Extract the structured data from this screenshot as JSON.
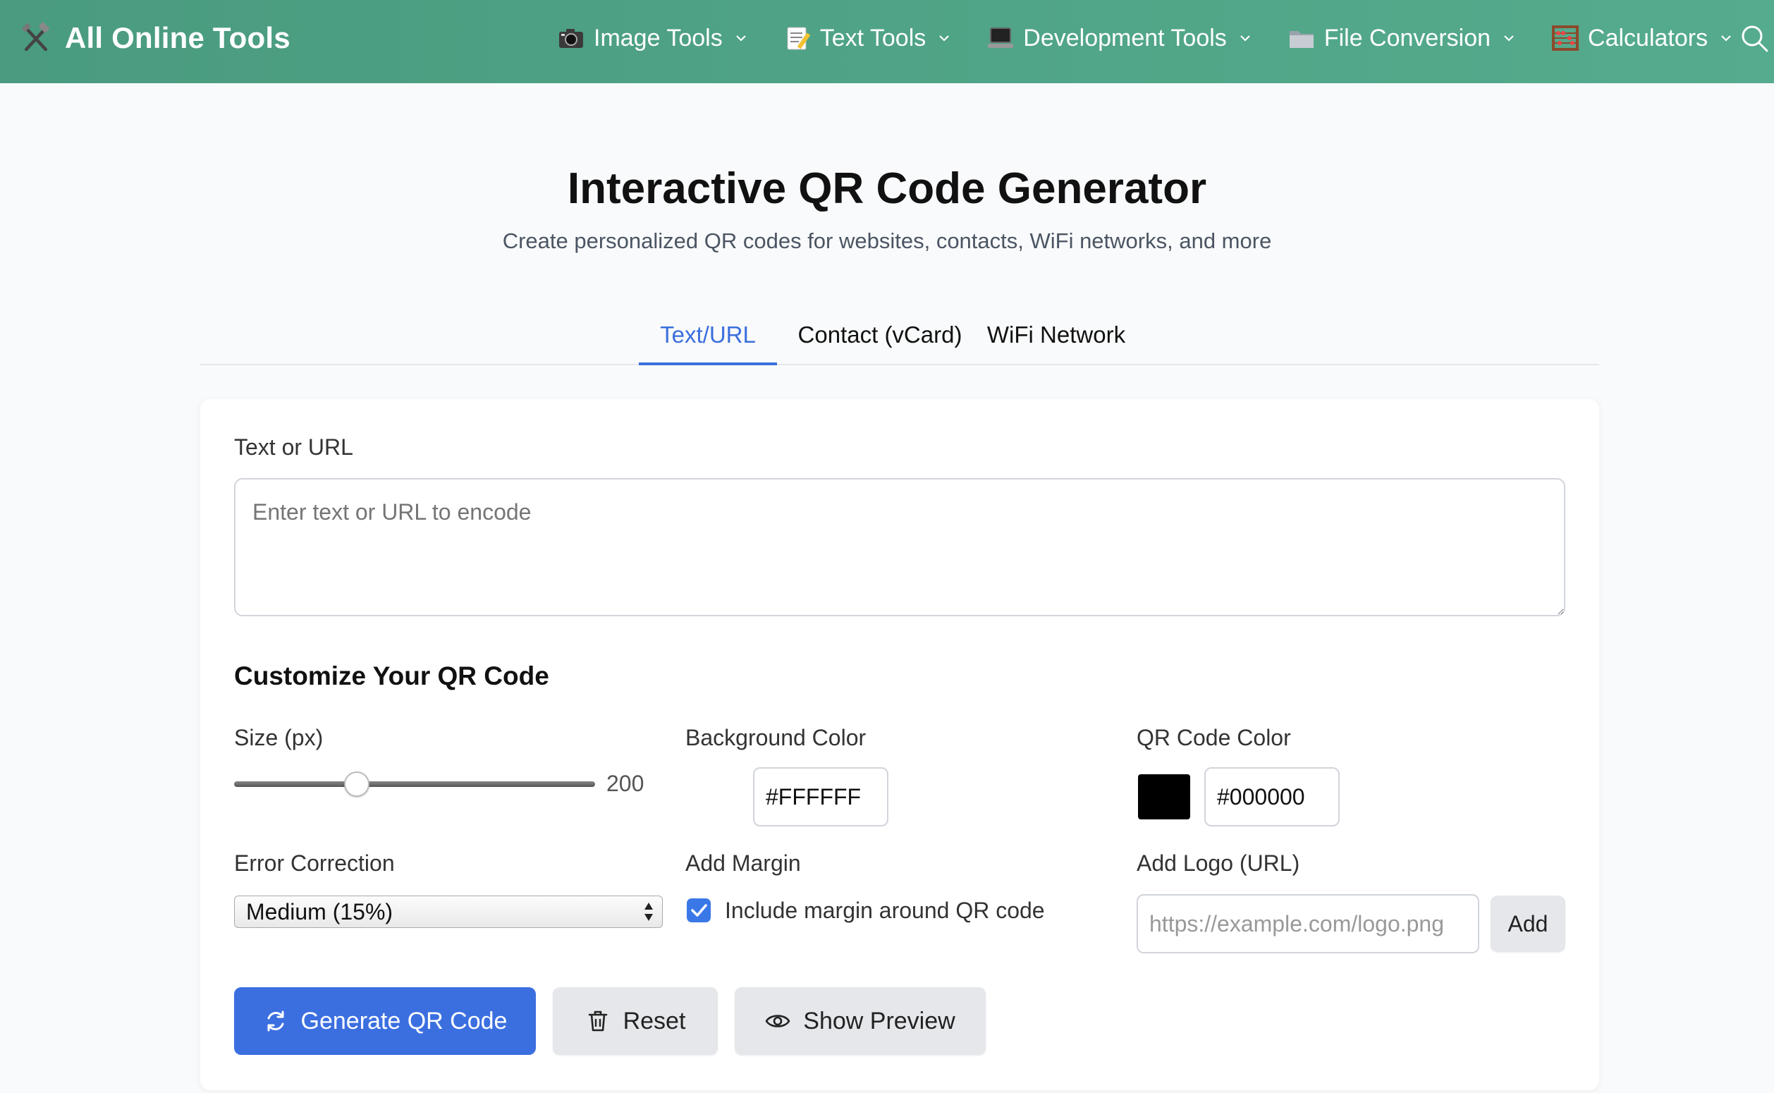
{
  "header": {
    "brand": "All Online Tools",
    "brand_icon": "tools-icon",
    "nav": [
      {
        "label": "Image Tools",
        "icon": "camera-icon"
      },
      {
        "label": "Text Tools",
        "icon": "memo-icon"
      },
      {
        "label": "Development Tools",
        "icon": "laptop-icon"
      },
      {
        "label": "File Conversion",
        "icon": "folder-icon"
      },
      {
        "label": "Calculators",
        "icon": "abacus-icon"
      }
    ],
    "gradient_start": "#4a9b7f",
    "gradient_end": "#55ab8d"
  },
  "page": {
    "title": "Interactive QR Code Generator",
    "subtitle": "Create personalized QR codes for websites, contacts, WiFi networks, and more"
  },
  "tabs": [
    {
      "label": "Text/URL",
      "active": true
    },
    {
      "label": "Contact (vCard)",
      "active": false
    },
    {
      "label": "WiFi Network",
      "active": false
    }
  ],
  "form": {
    "text_label": "Text or URL",
    "text_placeholder": "Enter text or URL to encode",
    "text_value": "",
    "customize_title": "Customize Your QR Code",
    "size_label": "Size (px)",
    "size_value": "200",
    "size_fraction": 0.34,
    "bg_label": "Background Color",
    "bg_value": "#FFFFFF",
    "fg_label": "QR Code Color",
    "fg_value": "#000000",
    "ec_label": "Error Correction",
    "ec_value": "Medium (15%)",
    "margin_label": "Add Margin",
    "margin_checkbox_label": "Include margin around QR code",
    "margin_checked": true,
    "logo_label": "Add Logo (URL)",
    "logo_placeholder": "https://example.com/logo.png",
    "logo_add": "Add"
  },
  "actions": {
    "generate": "Generate QR Code",
    "reset": "Reset",
    "preview": "Show Preview"
  },
  "colors": {
    "accent": "#3b6fe0",
    "tab_active": "#3b6fdc"
  }
}
